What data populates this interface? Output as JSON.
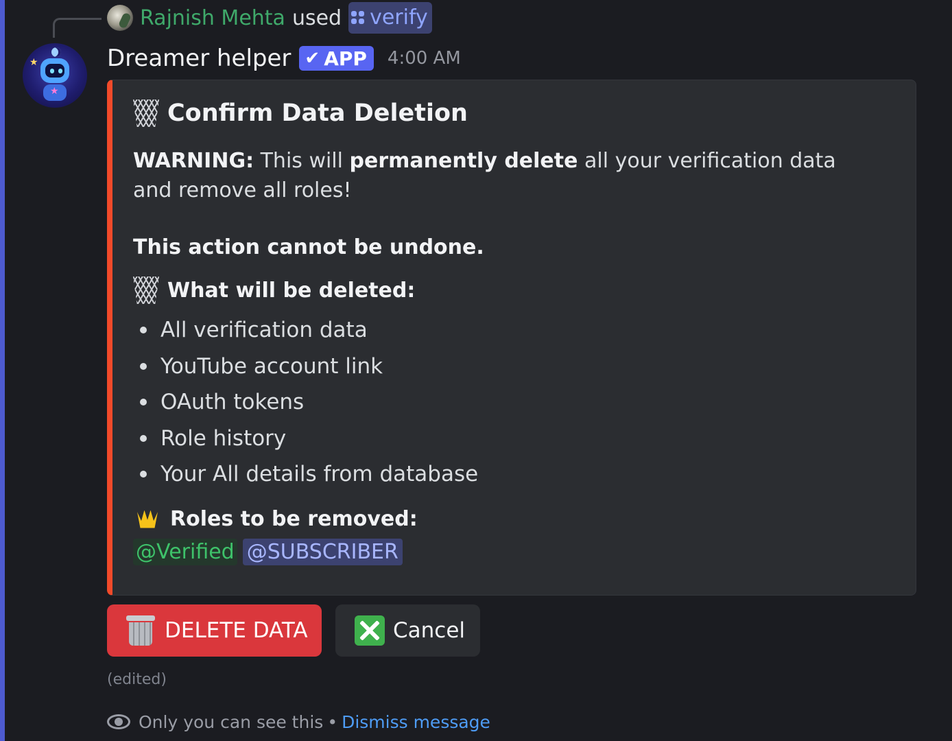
{
  "reply": {
    "username": "Rajnish Mehta",
    "used_text": "used",
    "command": "verify"
  },
  "message": {
    "author": "Dreamer helper",
    "badge": "APP",
    "timestamp": "4:00 AM",
    "edited": "(edited)"
  },
  "embed": {
    "accent_color": "#f24a2a",
    "title": "Confirm Data Deletion",
    "warning_label": "WARNING:",
    "warning_text_1": " This will ",
    "warning_bold": "permanently delete",
    "warning_text_2": " all your verification data and remove all roles!",
    "undone": "This action cannot be undone.",
    "deleted_heading": "What will be deleted:",
    "deleted_items": [
      "All verification data",
      "YouTube account link",
      "OAuth tokens",
      "Role history",
      "Your All details from database"
    ],
    "roles_heading": "Roles to be removed:",
    "roles": [
      "@Verified",
      "@SUBSCRIBER"
    ]
  },
  "buttons": {
    "delete_label": "DELETE DATA",
    "cancel_label": "Cancel"
  },
  "footer": {
    "only_you": "Only you can see this",
    "separator": "•",
    "dismiss": "Dismiss message"
  },
  "icons": {
    "command": "app-command-icon",
    "title": "basket-icon",
    "roles": "crown-icon",
    "delete": "wastebasket-icon",
    "cancel": "cross-mark-icon",
    "ephemeral": "eye-icon"
  }
}
